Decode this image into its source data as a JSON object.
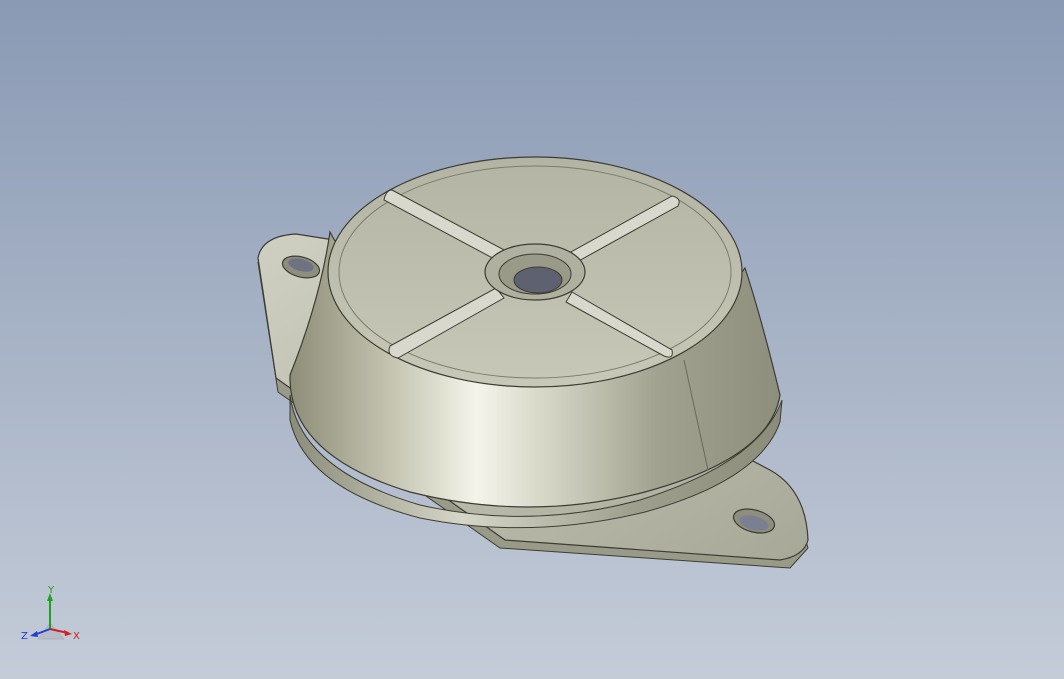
{
  "viewport": {
    "background_top": "#8a9ab4",
    "background_bottom": "#c4ccd8",
    "model": "rubber-mount-part",
    "model_color": "#c8c8b8"
  },
  "triad": {
    "x_label": "X",
    "y_label": "Y",
    "z_label": "Z",
    "x_color": "#d02020",
    "y_color": "#20a020",
    "z_color": "#2040d0"
  }
}
